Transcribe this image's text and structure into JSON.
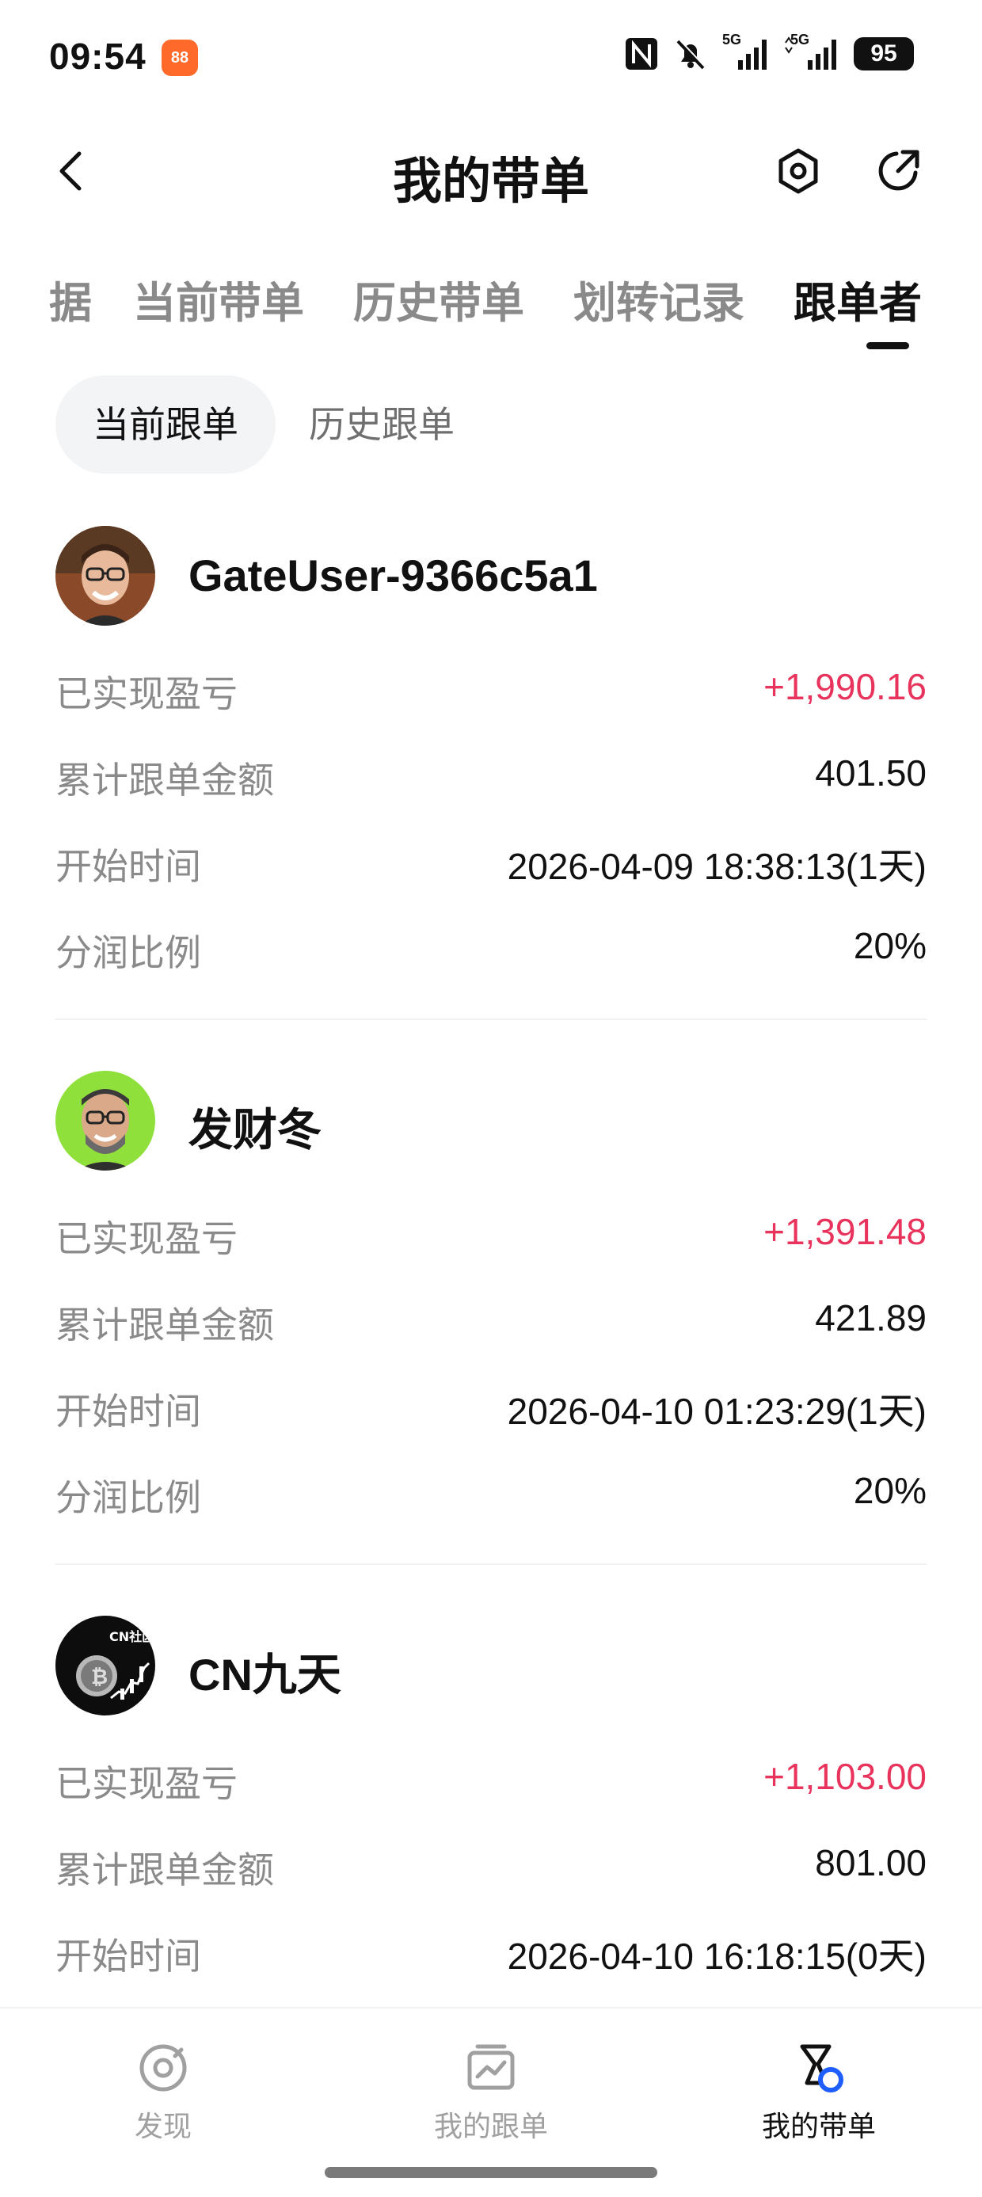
{
  "status_bar": {
    "time": "09:54",
    "app_icon_text": "88",
    "network_1": "5G",
    "network_2": "5G",
    "battery": "95"
  },
  "header": {
    "title": "我的带单"
  },
  "main_tabs": [
    {
      "label": "据",
      "active": false
    },
    {
      "label": "当前带单",
      "active": false
    },
    {
      "label": "历史带单",
      "active": false
    },
    {
      "label": "划转记录",
      "active": false
    },
    {
      "label": "跟单者",
      "active": true
    }
  ],
  "sub_tabs": [
    {
      "label": "当前跟单",
      "active": true
    },
    {
      "label": "历史跟单",
      "active": false
    }
  ],
  "followers": [
    {
      "name": "GateUser-9366c5a1",
      "realized_pnl_label": "已实现盈亏",
      "realized_pnl": "+1,990.16",
      "total_amount_label": "累计跟单金额",
      "total_amount": "401.50",
      "start_time_label": "开始时间",
      "start_time": "2026-04-09 18:38:13(1天)",
      "profit_share_label": "分润比例",
      "profit_share": "20%"
    },
    {
      "name": "发财冬",
      "realized_pnl_label": "已实现盈亏",
      "realized_pnl": "+1,391.48",
      "total_amount_label": "累计跟单金额",
      "total_amount": "421.89",
      "start_time_label": "开始时间",
      "start_time": "2026-04-10 01:23:29(1天)",
      "profit_share_label": "分润比例",
      "profit_share": "20%"
    },
    {
      "name": "CN九天",
      "avatar_text": "CN社区",
      "realized_pnl_label": "已实现盈亏",
      "realized_pnl": "+1,103.00",
      "total_amount_label": "累计跟单金额",
      "total_amount": "801.00",
      "start_time_label": "开始时间",
      "start_time": "2026-04-10 16:18:15(0天)"
    }
  ],
  "bottom_nav": [
    {
      "label": "发现",
      "icon": "discover-icon",
      "active": false
    },
    {
      "label": "我的跟单",
      "icon": "chart-icon",
      "active": false
    },
    {
      "label": "我的带单",
      "icon": "lead-trade-icon",
      "active": true
    }
  ],
  "colors": {
    "profit": "#e8345d",
    "active_text": "#111111",
    "inactive_text": "#8a8a8a",
    "pill_bg": "#f3f4f6",
    "nav_badge": "#1e5eff"
  }
}
